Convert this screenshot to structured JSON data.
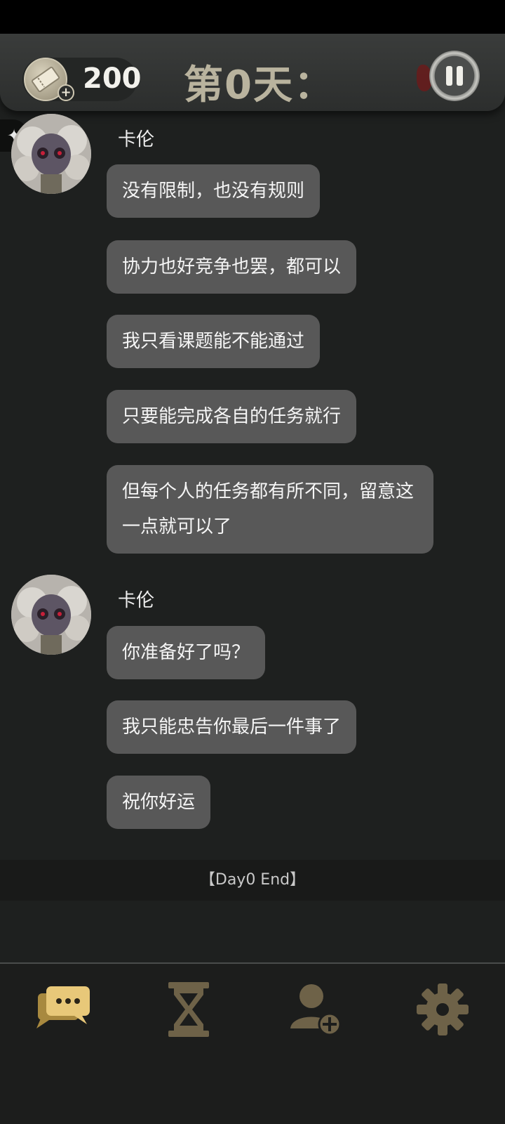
{
  "header": {
    "ticket_count": "200",
    "day_title": "第0天："
  },
  "messages": [
    {
      "sender": "卡伦",
      "bubbles": [
        "没有限制，也没有规则",
        "协力也好竞争也罢，都可以",
        "我只看课题能不能通过",
        "只要能完成各自的任务就行",
        "但每个人的任务都有所不同，留意这一点就可以了"
      ]
    },
    {
      "sender": "卡伦",
      "bubbles": [
        "你准备好了吗？",
        "我只能忠告你最后一件事了",
        "祝你好运"
      ]
    }
  ],
  "day_end": "【Day0 End】",
  "nav": {
    "items": [
      "chat-icon",
      "hourglass-icon",
      "add-friend-icon",
      "gear-icon"
    ],
    "active_color": "#e8c879",
    "inactive_color": "#6e6248"
  },
  "theme": {
    "bubble_color": "#585858",
    "title_color": "#b9b39e"
  }
}
